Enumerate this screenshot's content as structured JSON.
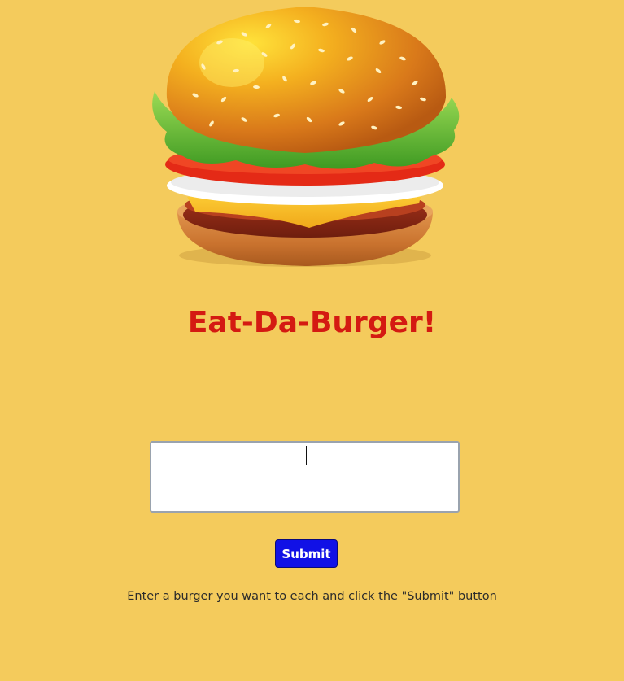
{
  "page": {
    "title": "Eat-Da-Burger!",
    "background_color": "#F4CB5C",
    "title_color": "#D41A12"
  },
  "hero": {
    "image_icon": "burger-illustration"
  },
  "form": {
    "burger_input": {
      "value": "",
      "placeholder": ""
    },
    "submit_label": "Submit",
    "submit_color": "#1111E6",
    "hint_text": "Enter a burger you want to each and click the \"Submit\" button"
  }
}
